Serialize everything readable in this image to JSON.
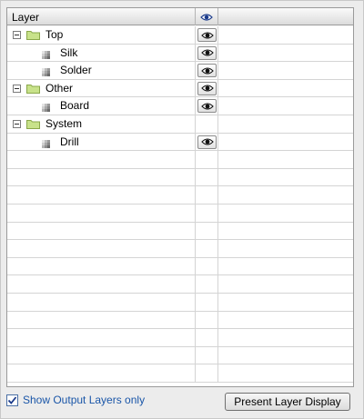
{
  "header": {
    "layer_column": "Layer",
    "visibility_icon": "eye-icon"
  },
  "tree": [
    {
      "type": "group",
      "label": "Top",
      "visible": true
    },
    {
      "type": "layer",
      "label": "Silk",
      "visible": true
    },
    {
      "type": "layer",
      "label": "Solder",
      "visible": true
    },
    {
      "type": "group",
      "label": "Other",
      "visible": true
    },
    {
      "type": "layer",
      "label": "Board",
      "visible": true
    },
    {
      "type": "group",
      "label": "System",
      "visible": false
    },
    {
      "type": "layer",
      "label": "Drill",
      "visible": true
    }
  ],
  "empty_row_count": 13,
  "footer": {
    "show_output_layers_label": "Show Output Layers only",
    "show_output_layers_checked": true,
    "present_button_label": "Present Layer Display"
  },
  "colors": {
    "folder": "#c8e28a",
    "accent_text": "#1a56a8",
    "eye": "#1a3a8a"
  }
}
